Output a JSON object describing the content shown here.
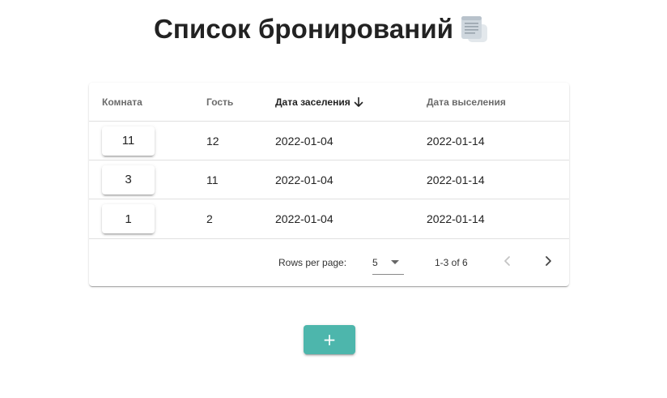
{
  "page": {
    "title": "Список бронирований",
    "title_icon": "scroll-icon"
  },
  "table": {
    "columns": [
      {
        "label": "Комната"
      },
      {
        "label": "Гость"
      },
      {
        "label": "Дата заселения",
        "sorted": "desc"
      },
      {
        "label": "Дата выселения"
      }
    ],
    "rows": [
      {
        "room": "11",
        "guest": "12",
        "check_in": "2022-01-04",
        "check_out": "2022-01-14"
      },
      {
        "room": "3",
        "guest": "11",
        "check_in": "2022-01-04",
        "check_out": "2022-01-14"
      },
      {
        "room": "1",
        "guest": "2",
        "check_in": "2022-01-04",
        "check_out": "2022-01-14"
      }
    ],
    "pagination": {
      "rows_per_page_label": "Rows per page:",
      "rows_per_page": "5",
      "range": "1-3 of 6",
      "prev_enabled": false,
      "next_enabled": true
    }
  },
  "actions": {
    "add_label": "+"
  },
  "colors": {
    "accent": "#4db6ac",
    "divider": "#e0e0e0",
    "disabled": "#c4c4c4"
  }
}
